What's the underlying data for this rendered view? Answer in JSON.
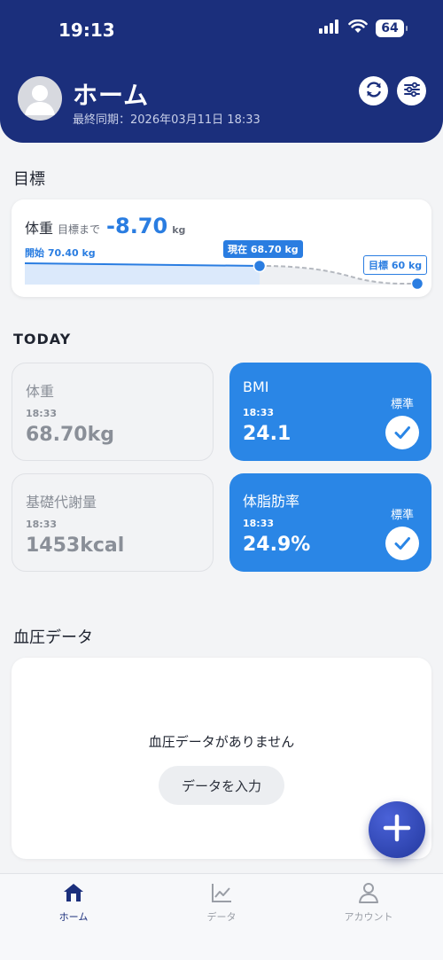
{
  "status_bar": {
    "time": "19:13",
    "battery": "64"
  },
  "header": {
    "title": "ホーム",
    "sync_text": "最終同期：2026年03月11日 18:33"
  },
  "goal": {
    "section_title": "目標",
    "label": "体重",
    "remaining_label": "目標まで",
    "remaining_value": "-8.70",
    "remaining_unit": "kg",
    "start_label": "開始 70.40 kg",
    "current_label": "現在 68.70 kg",
    "target_label": "目標 60 kg",
    "progress": {
      "start": 70.4,
      "current": 68.7,
      "target": 60
    }
  },
  "today": {
    "section_title": "TODAY",
    "cards": [
      {
        "label": "体重",
        "time": "18:33",
        "value": "68.70kg"
      },
      {
        "label": "BMI",
        "time": "18:33",
        "value": "24.1",
        "status": "標準"
      },
      {
        "label": "基礎代謝量",
        "time": "18:33",
        "value": "1453kcal"
      },
      {
        "label": "体脂肪率",
        "time": "18:33",
        "value": "24.9%",
        "status": "標準"
      }
    ]
  },
  "blood_pressure": {
    "section_title": "血圧データ",
    "empty_message": "血圧データがありません",
    "input_button": "データを入力"
  },
  "nav": {
    "items": [
      {
        "label": "ホーム",
        "icon": "home-icon",
        "active": true
      },
      {
        "label": "データ",
        "icon": "chart-icon",
        "active": false
      },
      {
        "label": "アカウント",
        "icon": "person-icon",
        "active": false
      }
    ]
  },
  "colors": {
    "header": "#1b2f7c",
    "accent": "#2a7de1",
    "card_blue": "#2a86e6",
    "fab": "#2d44b8"
  }
}
